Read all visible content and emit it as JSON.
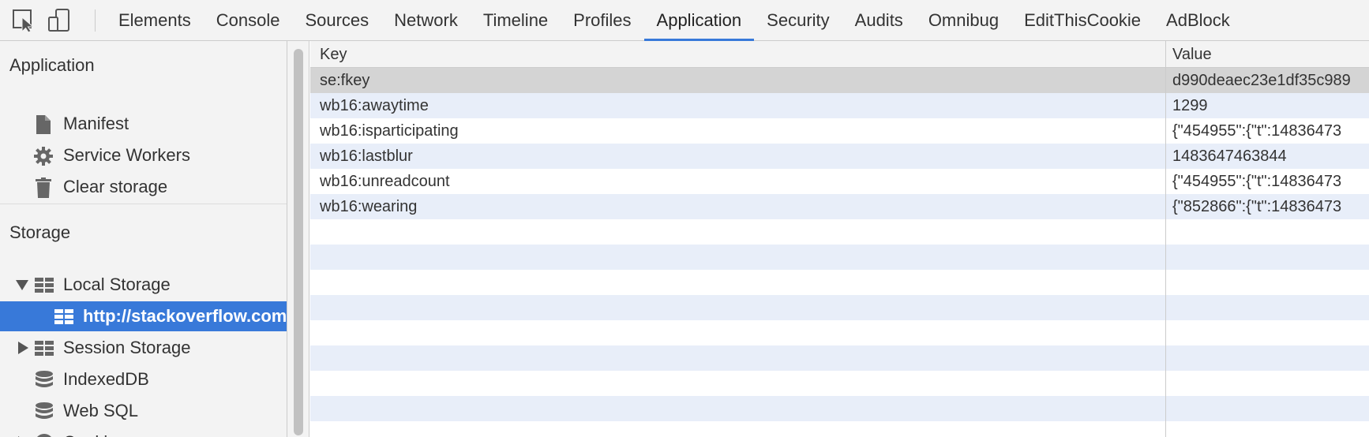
{
  "toolbar": {
    "tabs": [
      {
        "label": "Elements"
      },
      {
        "label": "Console"
      },
      {
        "label": "Sources"
      },
      {
        "label": "Network"
      },
      {
        "label": "Timeline"
      },
      {
        "label": "Profiles"
      },
      {
        "label": "Application",
        "active": true
      },
      {
        "label": "Security"
      },
      {
        "label": "Audits"
      },
      {
        "label": "Omnibug"
      },
      {
        "label": "EditThisCookie"
      },
      {
        "label": "AdBlock"
      }
    ],
    "accent_color": "#3879d9"
  },
  "sidebar": {
    "application_title": "Application",
    "application_items": [
      {
        "label": "Manifest",
        "icon": "file-icon"
      },
      {
        "label": "Service Workers",
        "icon": "gear-icon"
      },
      {
        "label": "Clear storage",
        "icon": "trash-icon"
      }
    ],
    "storage_title": "Storage",
    "storage_items": [
      {
        "label": "Local Storage",
        "icon": "grid-icon",
        "expanded": true
      },
      {
        "label": "http://stackoverflow.com",
        "icon": "grid-icon",
        "selected": true
      },
      {
        "label": "Session Storage",
        "icon": "grid-icon",
        "expanded": false
      },
      {
        "label": "IndexedDB",
        "icon": "database-icon"
      },
      {
        "label": "Web SQL",
        "icon": "database-icon"
      },
      {
        "label": "Cookies",
        "icon": "cookie-icon",
        "expanded": false
      }
    ]
  },
  "table": {
    "headers": {
      "key": "Key",
      "value": "Value"
    },
    "rows": [
      {
        "key": "se:fkey",
        "value": "d990deaec23e1df35c989",
        "selected": true
      },
      {
        "key": "wb16:awaytime",
        "value": "1299"
      },
      {
        "key": "wb16:isparticipating",
        "value": "{\"454955\":{\"t\":14836473"
      },
      {
        "key": "wb16:lastblur",
        "value": "1483647463844"
      },
      {
        "key": "wb16:unreadcount",
        "value": "{\"454955\":{\"t\":14836473"
      },
      {
        "key": "wb16:wearing",
        "value": "{\"852866\":{\"t\":14836473"
      }
    ]
  }
}
